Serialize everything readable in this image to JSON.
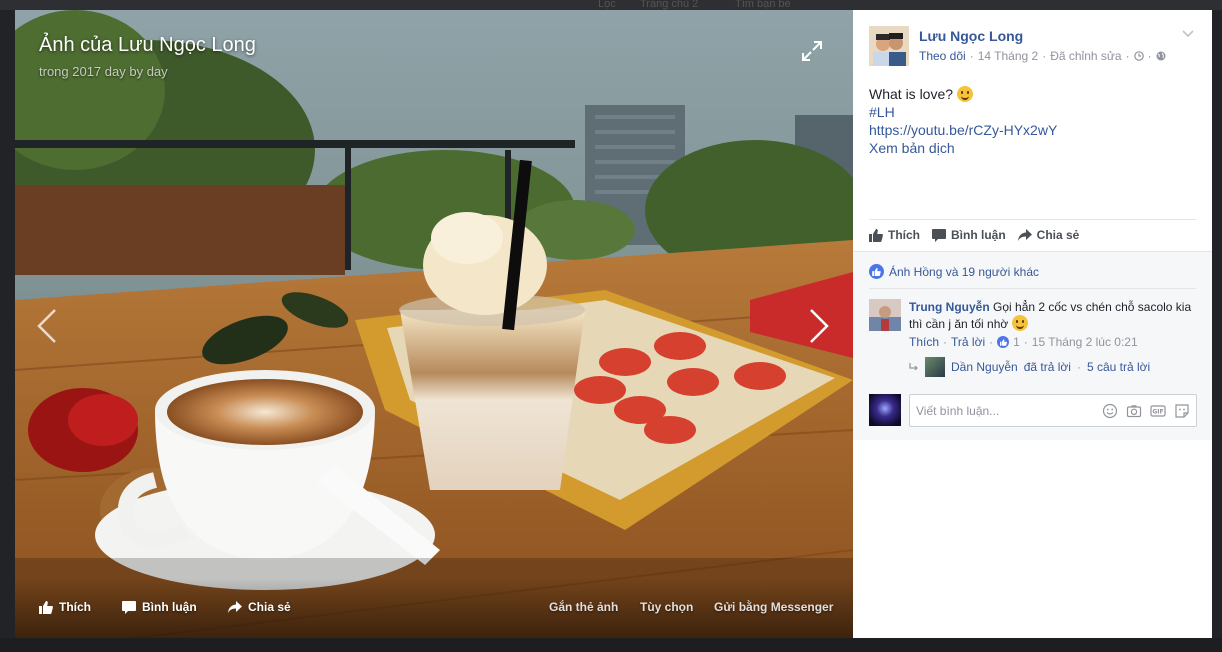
{
  "photo": {
    "title": "Ảnh của Lưu Ngọc Long",
    "subtitle": "trong 2017 day by day",
    "actions": {
      "like": "Thích",
      "comment": "Bình luận",
      "share": "Chia sẻ",
      "tag": "Gắn thẻ ảnh",
      "options": "Tùy chọn",
      "send": "Gửi bằng Messenger"
    }
  },
  "post": {
    "author": "Lưu Ngọc Long",
    "follow": "Theo dõi",
    "date": "14 Tháng 2",
    "edited": "Đã chỉnh sửa",
    "separator": "·",
    "text_line": "What is love?",
    "hashtag": "#LH",
    "url": "https://youtu.be/rCZy-HYx2wY",
    "translate": "Xem bản dịch",
    "actions": {
      "like": "Thích",
      "comment": "Bình luận",
      "share": "Chia sẻ"
    },
    "likes_summary": "Ánh Hồng và 19 người khác"
  },
  "comment": {
    "author": "Trung Nguyễn",
    "text": "Gọi hẳn 2 cốc vs chén chỗ sacolo kia thì cần j ăn tối nhờ",
    "like": "Thích",
    "reply": "Trả lời",
    "like_count": "1",
    "time": "15 Tháng 2 lúc 0:21",
    "reply_author": "Dần Nguyễn",
    "reply_text": "đã trả lời",
    "reply_separator": "·",
    "reply_count": "5 câu trả lời"
  },
  "composer": {
    "placeholder": "Viết bình luận..."
  },
  "background_hint": {
    "a": "Lọc",
    "b": "Trang chủ 2",
    "c": "Tìm bạn bè"
  },
  "colors": {
    "link": "#365899",
    "meta": "#90949c",
    "text": "#1d2129"
  }
}
